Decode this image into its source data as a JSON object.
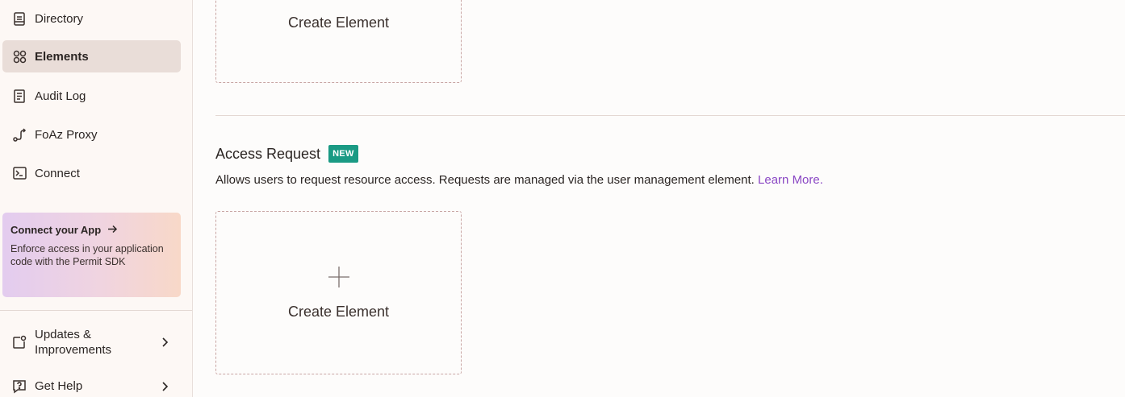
{
  "sidebar": {
    "items": [
      {
        "label": "Directory",
        "icon": "directory-icon",
        "active": false
      },
      {
        "label": "Elements",
        "icon": "elements-icon",
        "active": true
      },
      {
        "label": "Audit Log",
        "icon": "audit-log-icon",
        "active": false
      },
      {
        "label": "FoAz Proxy",
        "icon": "proxy-icon",
        "active": false
      },
      {
        "label": "Connect",
        "icon": "terminal-icon",
        "active": false
      }
    ],
    "promo": {
      "title": "Connect your App",
      "body": "Enforce access in your application code with the Permit SDK"
    },
    "bottom": [
      {
        "label": "Updates & Improvements",
        "icon": "updates-icon"
      },
      {
        "label": "Get Help",
        "icon": "help-icon"
      }
    ]
  },
  "main": {
    "top_card": {
      "label": "Create Element"
    },
    "section": {
      "title": "Access Request",
      "badge": "NEW",
      "description": "Allows users to request resource access. Requests are managed via the user management element.",
      "link": "Learn More."
    },
    "card": {
      "label": "Create Element",
      "icon": "plus-icon"
    }
  },
  "colors": {
    "badge": "#1a9a84",
    "link": "#8a47c4",
    "active_item": "#e9ddd8",
    "card_border": "#c8a5a3"
  }
}
